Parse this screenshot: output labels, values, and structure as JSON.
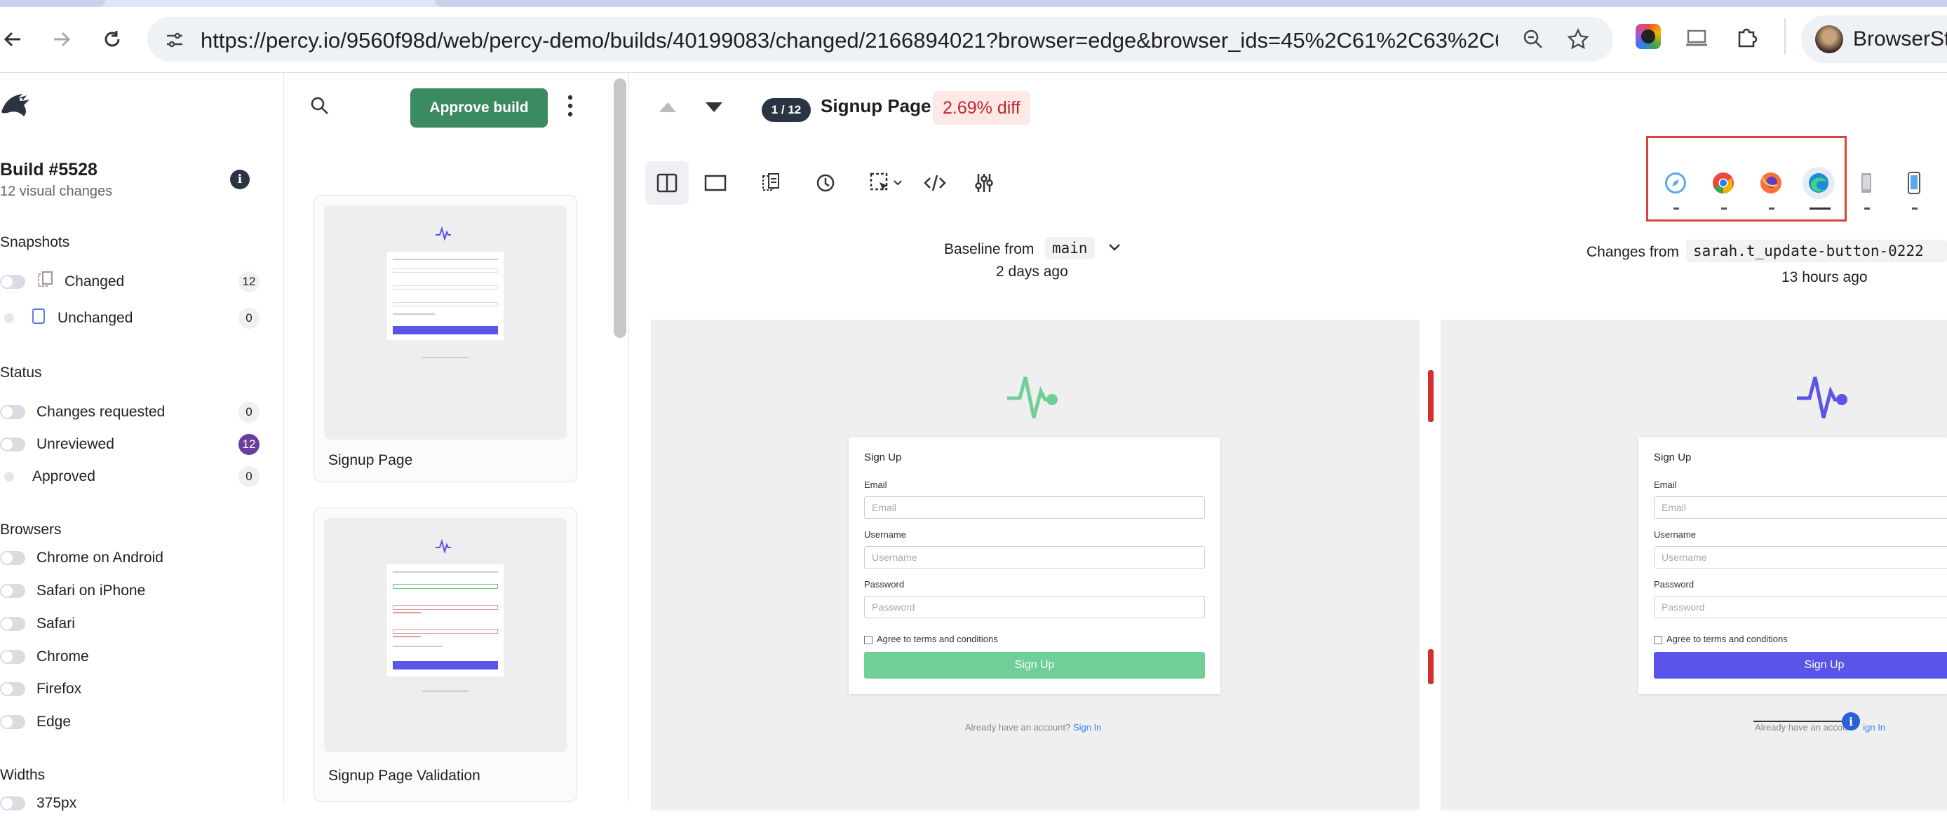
{
  "browser": {
    "url": "https://percy.io/9560f98d/web/percy-demo/builds/40199083/changed/2166894021?browser=edge&browser_ids=45%2C61%2C63%2C6...",
    "profile_label": "BrowserSta"
  },
  "sidebar": {
    "build_title": "Build #5528",
    "build_subtitle": "12 visual changes",
    "snapshots_heading": "Snapshots",
    "snapshots": [
      {
        "label": "Changed",
        "count": "12"
      },
      {
        "label": "Unchanged",
        "count": "0"
      }
    ],
    "status_heading": "Status",
    "status": [
      {
        "label": "Changes requested",
        "count": "0"
      },
      {
        "label": "Unreviewed",
        "count": "12"
      },
      {
        "label": "Approved",
        "count": "0"
      }
    ],
    "browsers_heading": "Browsers",
    "browsers": [
      "Chrome on Android",
      "Safari on iPhone",
      "Safari",
      "Chrome",
      "Firefox",
      "Edge"
    ],
    "widths_heading": "Widths",
    "widths_first": "375px"
  },
  "list": {
    "approve_label": "Approve build",
    "cards": [
      {
        "caption": "Signup Page"
      },
      {
        "caption": "Signup Page Validation"
      }
    ]
  },
  "main": {
    "position": "1 / 12",
    "snapshot_title": "Signup Page",
    "diff_label": "2.69% diff",
    "browser_icons": [
      "safari-icon",
      "chrome-icon",
      "firefox-icon",
      "edge-icon",
      "android-device-icon",
      "iphone-device-icon"
    ],
    "baseline": {
      "label": "Baseline from",
      "branch": "main",
      "time": "2 days ago"
    },
    "changes": {
      "label": "Changes from",
      "branch": "sarah.t_update-button-0222",
      "time": "13 hours ago"
    }
  },
  "form": {
    "title": "Sign Up",
    "email_label": "Email",
    "email_placeholder": "Email",
    "username_label": "Username",
    "username_placeholder": "Username",
    "password_label": "Password",
    "password_placeholder": "Password",
    "terms_label": "Agree to terms and conditions",
    "submit_label": "Sign Up",
    "footer_text": "Already have an account?",
    "footer_link": "Sign In",
    "footer_text_head": "Already have an accou",
    "footer_link_tail": "ign In"
  },
  "colors": {
    "baseline_accent": "#6fcf97",
    "changes_accent": "#5b54e8",
    "approve_green": "#3c8a5f",
    "diff_red": "#c0262d",
    "browser_highlight": "#d9443a"
  }
}
